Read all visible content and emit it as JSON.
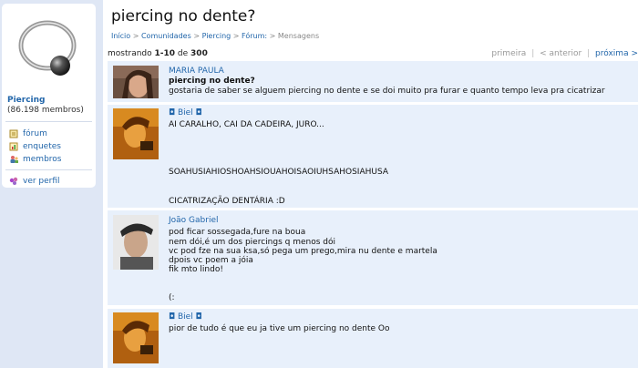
{
  "sidebar": {
    "community_name": "Piercing",
    "member_count": "(86.198 membros)",
    "links": [
      {
        "label": "fórum",
        "icon": "forum-icon"
      },
      {
        "label": "enquetes",
        "icon": "poll-icon"
      },
      {
        "label": "membros",
        "icon": "members-icon"
      },
      {
        "label": "ver perfil",
        "icon": "profile-icon"
      }
    ]
  },
  "page": {
    "title": "piercing no dente?",
    "breadcrumb": [
      "Início",
      "Comunidades",
      "Piercing",
      "Fórum:",
      "Mensagens"
    ],
    "breadcrumb_sep": ">"
  },
  "pager": {
    "prefix": "mostrando",
    "range": "1-10",
    "of": "de",
    "total": "300",
    "first": "primeira",
    "prev": "< anterior",
    "next": "próxima >",
    "divider": "|"
  },
  "posts": [
    {
      "author": "MARIA PAULA",
      "subject": "piercing no dente?",
      "lines": [
        "gostaria de saber se alguem piercing no dente e se doi muito pra furar e quanto tempo leva pra cicatrizar"
      ]
    },
    {
      "author": "◘ Biel ◘",
      "lines": [
        "AI CARALHO, CAI DA CADEIRA, JURO...",
        "SOAHUSIAHIOSHOAHSIOUAHOISAOIUHSAHOSIAHUSA",
        "CICATRIZAÇÃO DENTÁRIA :D"
      ]
    },
    {
      "author": "João Gabriel",
      "lines": [
        "pod ficar sossegada,fure na boua",
        "nem dói,é um dos piercings q menos dói",
        "vc pod fze na sua ksa,só pega um prego,mira nu dente e martela",
        "dpois vc poem a jóia",
        "fik mto lindo!",
        "(:"
      ]
    },
    {
      "author": "◘ Biel ◘",
      "lines": [
        "pior de tudo é que eu ja tive um piercing no dente Oo"
      ]
    }
  ]
}
